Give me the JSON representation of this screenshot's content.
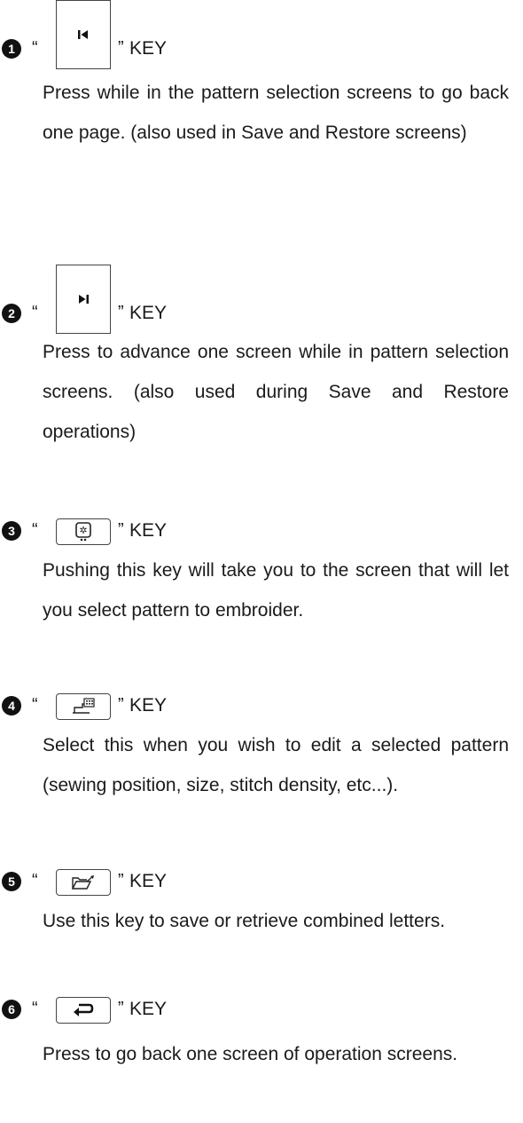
{
  "open_quote": "“",
  "close_quote": "”",
  "key_word": "KEY",
  "entries": [
    {
      "number": "1",
      "icon": "skip-back-icon",
      "description": "Press while in the pattern selection screens to go back one page. (also used in Save and Restore screens)"
    },
    {
      "number": "2",
      "icon": "skip-forward-icon",
      "description": "Press to advance one screen while in pattern selection screens. (also used during Save and Restore operations)"
    },
    {
      "number": "3",
      "icon": "embroidery-pattern-icon",
      "description": "Pushing this key will take you to the screen that will let you select pattern to embroider."
    },
    {
      "number": "4",
      "icon": "edit-pattern-icon",
      "description": "Select this when you wish to edit a selected pattern (sewing position, size, stitch density, etc...)."
    },
    {
      "number": "5",
      "icon": "folder-save-icon",
      "description": "Use this key to save or retrieve combined letters."
    },
    {
      "number": "6",
      "icon": "return-arrow-icon",
      "description": "Press to go back one screen of operation screens."
    }
  ]
}
